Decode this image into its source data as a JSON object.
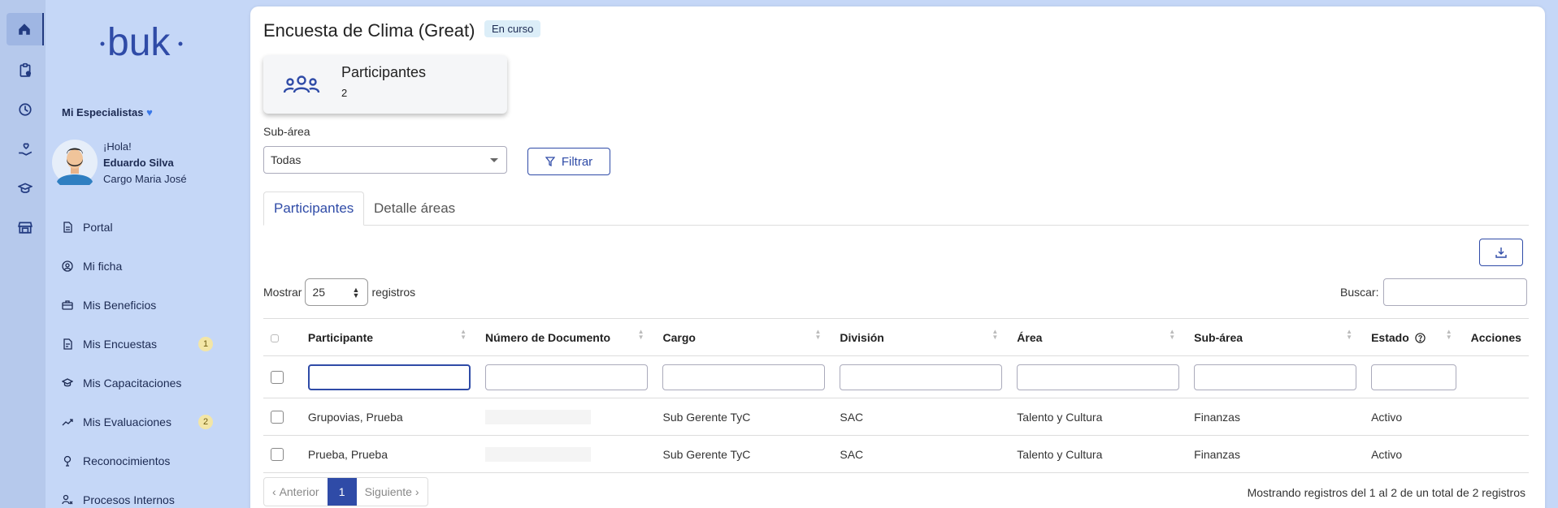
{
  "rail": [
    "home-icon",
    "clipboard-icon",
    "clock-icon",
    "hand-heart-icon",
    "graduation-cap-icon",
    "store-icon"
  ],
  "sidebar": {
    "logo_text": "·buk·",
    "section_title": "Mi Especialistas",
    "greeting": "¡Hola!",
    "user_name": "Eduardo Silva",
    "user_role": "Cargo Maria José",
    "items": [
      {
        "label": "Portal",
        "icon": "document-icon",
        "badge": ""
      },
      {
        "label": "Mi ficha",
        "icon": "user-circle-icon",
        "badge": ""
      },
      {
        "label": "Mis Beneficios",
        "icon": "briefcase-icon",
        "badge": ""
      },
      {
        "label": "Mis Encuestas",
        "icon": "survey-icon",
        "badge": "1"
      },
      {
        "label": "Mis Capacitaciones",
        "icon": "graduation-cap-icon",
        "badge": ""
      },
      {
        "label": "Mis Evaluaciones",
        "icon": "trend-up-icon",
        "badge": "2"
      },
      {
        "label": "Reconocimientos",
        "icon": "medal-icon",
        "badge": ""
      },
      {
        "label": "Procesos Internos",
        "icon": "process-icon",
        "badge": ""
      }
    ]
  },
  "header": {
    "title": "Encuesta de Clima (Great)",
    "status": "En curso"
  },
  "summary": {
    "title": "Participantes",
    "count": "2"
  },
  "filter": {
    "label": "Sub-área",
    "selected": "Todas",
    "button": "Filtrar"
  },
  "tabs": [
    {
      "label": "Participantes",
      "active": true
    },
    {
      "label": "Detalle áreas",
      "active": false
    }
  ],
  "table_controls": {
    "show_prefix": "Mostrar",
    "page_length": "25",
    "show_suffix": "registros",
    "search_label": "Buscar:"
  },
  "table": {
    "columns": [
      "Participante",
      "Número de Documento",
      "Cargo",
      "División",
      "Área",
      "Sub-área",
      "Estado",
      "Acciones"
    ],
    "rows": [
      {
        "participante": "Grupovias, Prueba",
        "documento": "",
        "cargo": "Sub Gerente TyC",
        "division": "SAC",
        "area": "Talento y Cultura",
        "subarea": "Finanzas",
        "estado": "Activo"
      },
      {
        "participante": "Prueba, Prueba",
        "documento": "",
        "cargo": "Sub Gerente TyC",
        "division": "SAC",
        "area": "Talento y Cultura",
        "subarea": "Finanzas",
        "estado": "Activo"
      }
    ]
  },
  "pagination": {
    "prev": "Anterior",
    "current": "1",
    "next": "Siguiente",
    "info": "Mostrando registros del 1 al 2 de un total de 2 registros"
  },
  "colors": {
    "primary": "#2f4ba7",
    "sidebar_bg": "#c5d7f7"
  }
}
